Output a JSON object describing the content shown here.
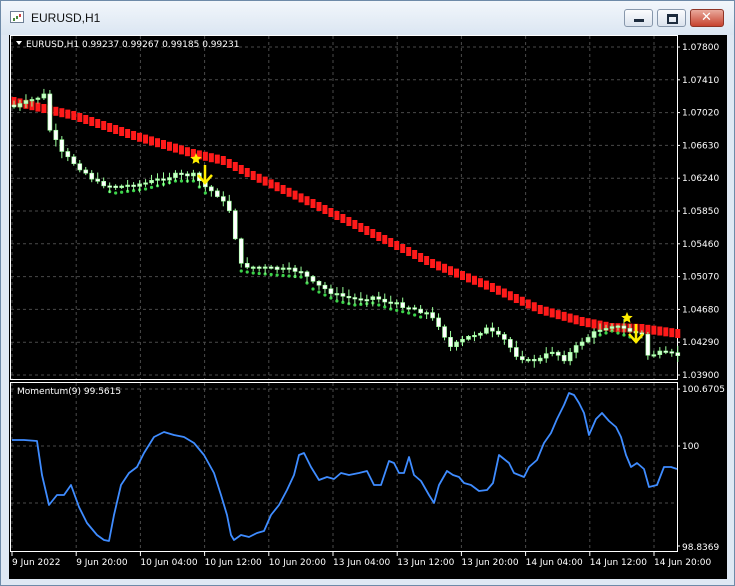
{
  "window": {
    "title": "EURUSD,H1",
    "close_glyph": "✕"
  },
  "main_chart": {
    "header": "EURUSD,H1  0.99237 0.99267 0.99185 0.99231",
    "price_labels": [
      "1.07800",
      "1.07410",
      "1.07020",
      "1.06630",
      "1.06240",
      "1.05850",
      "1.05460",
      "1.05070",
      "1.04680",
      "1.04290",
      "1.03900"
    ]
  },
  "indicator": {
    "label": "Momentum(9) 99.5615",
    "scale_labels": [
      "100.6705",
      "100",
      "98.8369"
    ]
  },
  "time_labels": [
    "9 Jun 2022",
    "9 Jun 20:00",
    "10 Jun 04:00",
    "10 Jun 12:00",
    "10 Jun 20:00",
    "13 Jun 04:00",
    "13 Jun 12:00",
    "13 Jun 20:00",
    "14 Jun 04:00",
    "14 Jun 12:00",
    "14 Jun 20:00"
  ],
  "colors": {
    "background": "#000000",
    "grid": "#4a4a4a",
    "candle_bull": "#c8ffc8",
    "candle_bear": "#ffffff",
    "trail_red": "#ff1a1a",
    "trail_green": "#3cd34a",
    "momentum_line": "#3f8cff",
    "signal": "#ffee00",
    "text": "#ffffff"
  }
}
